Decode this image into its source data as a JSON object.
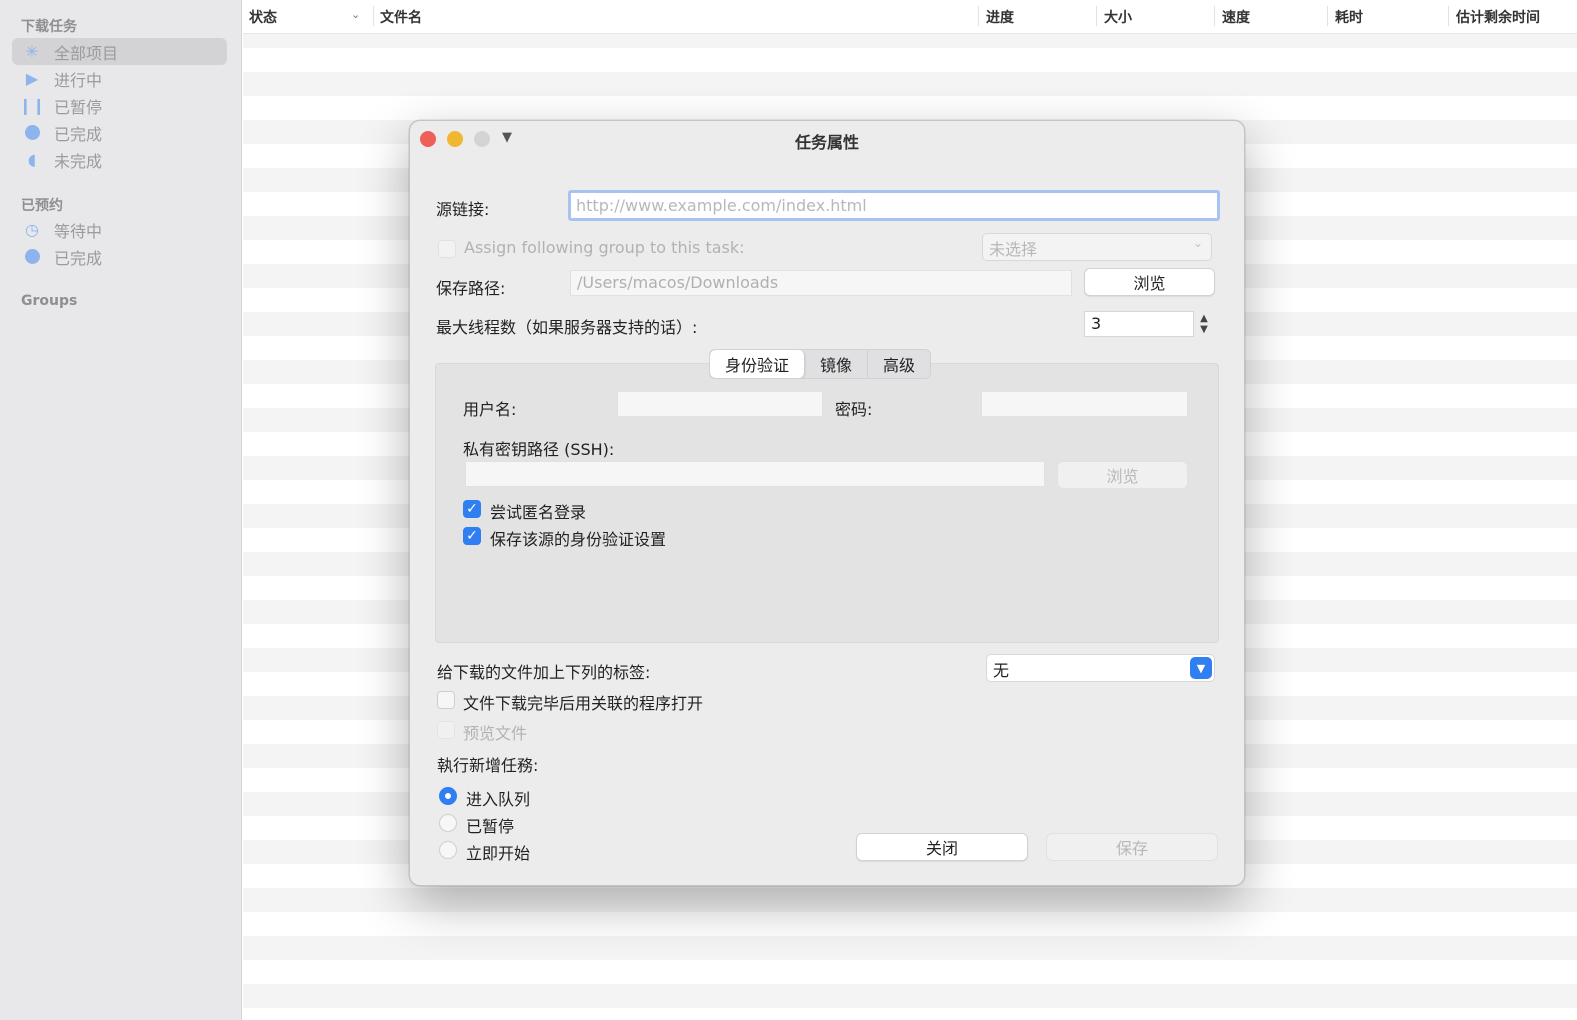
{
  "sidebar": {
    "section_downloads": "下载任务",
    "items": [
      {
        "label": "全部项目",
        "icon": "asterisk-icon"
      },
      {
        "label": "进行中",
        "icon": "play-icon"
      },
      {
        "label": "已暂停",
        "icon": "pause-icon"
      },
      {
        "label": "已完成",
        "icon": "circle-icon"
      },
      {
        "label": "未完成",
        "icon": "moon-icon"
      }
    ],
    "section_scheduled": "已预约",
    "scheduled_items": [
      {
        "label": "等待中",
        "icon": "clock-icon"
      },
      {
        "label": "已完成",
        "icon": "circle-icon"
      }
    ],
    "section_groups": "Groups"
  },
  "columns": [
    "状态",
    "文件名",
    "进度",
    "大小",
    "速度",
    "耗时",
    "估计剩余时间"
  ],
  "dialog": {
    "title": "任务属性",
    "source_label": "源链接:",
    "source_placeholder": "http://www.example.com/index.html",
    "assign_group_label": "Assign following group to this task:",
    "group_select_value": "未选择",
    "save_path_label": "保存路径:",
    "save_path_value": "/Users/macos/Downloads",
    "browse_label": "浏览",
    "max_threads_label": "最大线程数（如果服务器支持的话）:",
    "max_threads_value": "3",
    "tabs": [
      "身份验证",
      "镜像",
      "高级"
    ],
    "username_label": "用户名:",
    "password_label": "密码:",
    "ssh_key_label": "私有密钥路径 (SSH):",
    "ssh_browse_label": "浏览",
    "anon_login_label": "尝试匿名登录",
    "save_auth_label": "保存该源的身份验证设置",
    "tag_label": "给下载的文件加上下列的标签:",
    "tag_value": "无",
    "open_after_label": "文件下载完毕后用关联的程序打开",
    "preview_label": "预览文件",
    "exec_new_label": "執行新增任務:",
    "radio_options": [
      "进入队列",
      "已暂停",
      "立即开始"
    ],
    "close_label": "关闭",
    "save_label": "保存"
  },
  "colors": {
    "accent": "#2f7ff3",
    "sidebar_icon": "#8eb4ee"
  }
}
